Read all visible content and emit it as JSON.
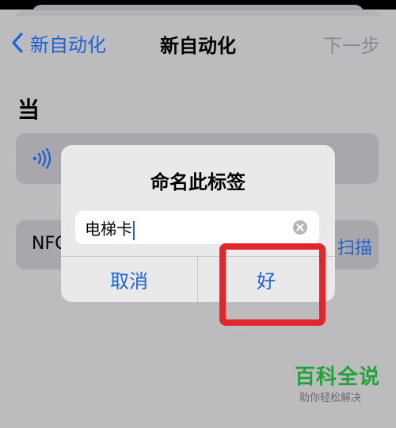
{
  "nav": {
    "back_label": "新自动化",
    "title": "新自动化",
    "next_label": "下一步"
  },
  "section": {
    "title": "当"
  },
  "rows": {
    "nfc_label": "NFC",
    "scan_label": "扫描"
  },
  "dialog": {
    "title": "命名此标签",
    "input_value": "电梯卡",
    "cancel_label": "取消",
    "ok_label": "好"
  },
  "watermark": {
    "main": "百科全说",
    "sub": "助你轻松解决"
  },
  "colors": {
    "accent": "#1d62d6",
    "highlight": "#e3262b",
    "watermark_green": "#23a23a"
  },
  "icons": {
    "back": "chevron-left-icon",
    "nfc": "nfc-wave-icon",
    "clear": "clear-circle-icon"
  }
}
